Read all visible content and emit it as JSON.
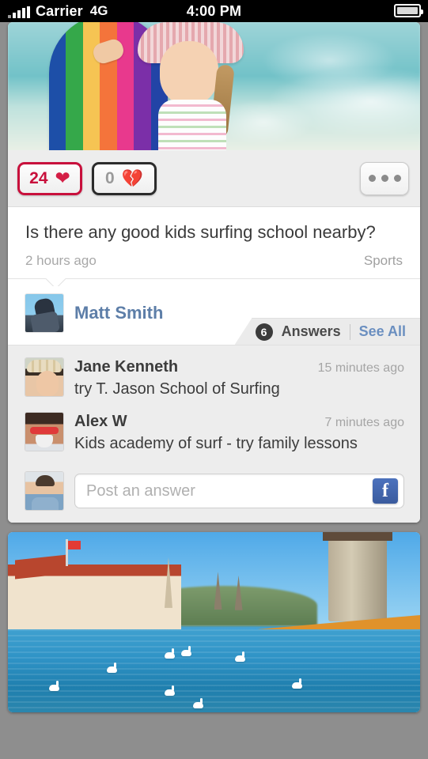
{
  "statusbar": {
    "carrier": "Carrier",
    "network": "4G",
    "time": "4:00 PM",
    "signal_icon": "signal-bars-icon",
    "battery_icon": "battery-icon"
  },
  "post": {
    "hero_photo_alt": "girl-with-rainbow-surfboard-at-beach",
    "actions": {
      "like_count": "24",
      "like_icon": "heart-icon",
      "dislike_count": "0",
      "dislike_icon": "broken-heart-icon",
      "more_icon": "ellipsis-icon",
      "like_color": "#c8103c",
      "dislike_color": "#2b2b2b"
    },
    "question": {
      "title": "Is there any good kids surfing school nearby?",
      "time": "2 hours ago",
      "category": "Sports"
    },
    "author": {
      "name": "Matt Smith",
      "avatar_alt": "avatar-matt-smith",
      "name_color": "#5d7ea8"
    },
    "answers_bar": {
      "count": "6",
      "label": "Answers",
      "see_all": "See All",
      "see_all_color": "#6b8fc0"
    },
    "answers": [
      {
        "name": "Jane Kenneth",
        "time": "15 minutes ago",
        "text": "try T. Jason School of Surfing",
        "avatar_alt": "avatar-jane-kenneth"
      },
      {
        "name": "Alex W",
        "time": "7 minutes ago",
        "text": "Kids academy of surf - try family lessons",
        "avatar_alt": "avatar-alex-w"
      }
    ],
    "compose": {
      "placeholder": "Post an answer",
      "value": "",
      "avatar_alt": "avatar-current-user",
      "share_icon": "facebook-icon",
      "facebook_color": "#3a5b9e"
    }
  },
  "next_post": {
    "photo_alt": "lucerne-chapel-bridge-with-swans"
  }
}
